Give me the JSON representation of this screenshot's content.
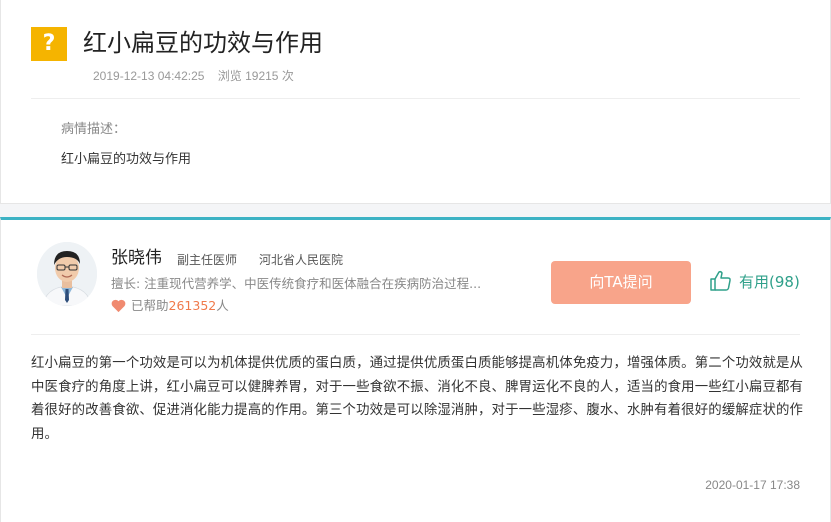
{
  "question": {
    "badge": "?",
    "title": "红小扁豆的功效与作用",
    "date": "2019-12-13 04:42:25",
    "views": "浏览 19215 次",
    "description_label": "病情描述：",
    "description": "红小扁豆的功效与作用"
  },
  "doctor": {
    "name": "张晓伟",
    "title": "副主任医师",
    "hospital": "河北省人民医院",
    "specialty": "擅长: 注重现代营养学、中医传统食疗和医体融合在疾病防治过程...",
    "helped_prefix": "已帮助",
    "helped_count": "261352",
    "helped_suffix": "人",
    "ask_button": "向TA提问",
    "useful_label": "有用(98)"
  },
  "answer": {
    "text": "红小扁豆的第一个功效是可以为机体提供优质的蛋白质，通过提供优质蛋白质能够提高机体免疫力，增强体质。第二个功效就是从中医食疗的角度上讲，红小扁豆可以健脾养胃，对于一些食欲不振、消化不良、脾胃运化不良的人，适当的食用一些红小扁豆都有着很好的改善食欲、促进消化能力提高的作用。第三个功效是可以除湿消肿，对于一些湿疹、腹水、水肿有着很好的缓解症状的作用。",
    "date": "2020-01-17 17:38"
  },
  "colors": {
    "badge": "#f5b400",
    "accent_line": "#3cb2c4",
    "ask_button": "#f8a48a",
    "useful": "#2fa08a",
    "helped_count": "#f07a4b"
  },
  "icons": {
    "badge": "question-mark-icon",
    "heart": "heart-icon",
    "thumb": "thumbs-up-icon",
    "avatar": "doctor-avatar"
  }
}
